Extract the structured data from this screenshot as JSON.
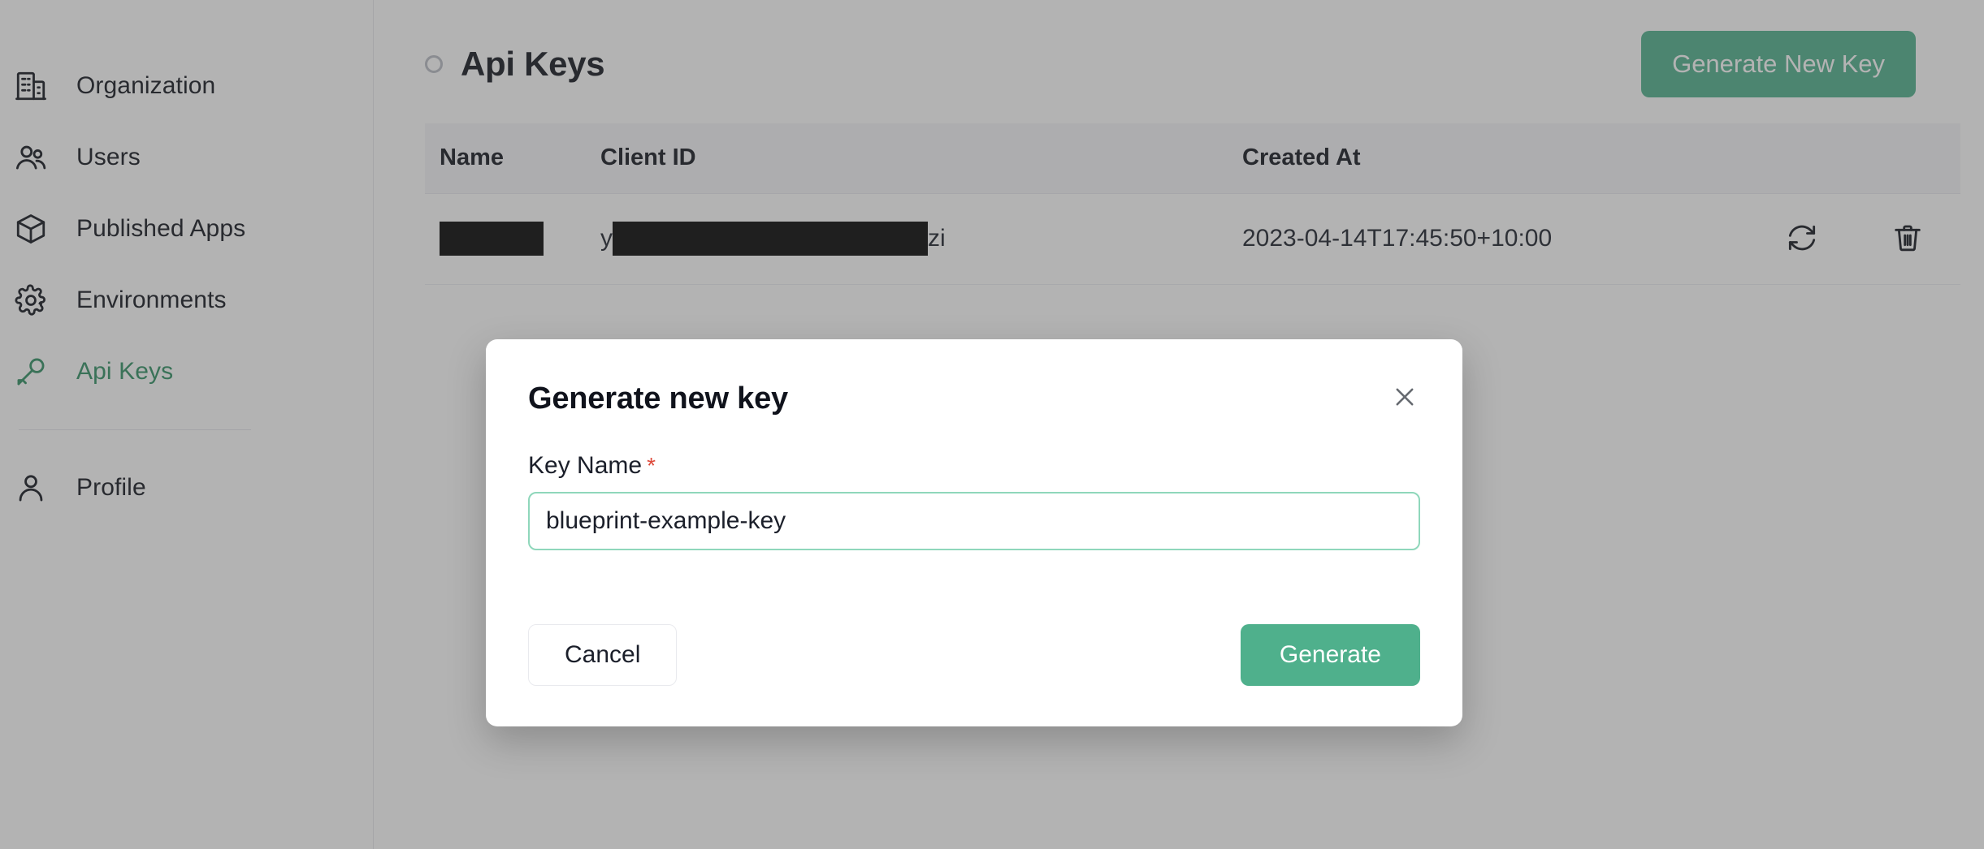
{
  "sidebar": {
    "items": [
      {
        "label": "Organization",
        "icon": "building-icon",
        "active": false
      },
      {
        "label": "Users",
        "icon": "users-icon",
        "active": false
      },
      {
        "label": "Published Apps",
        "icon": "cube-icon",
        "active": false
      },
      {
        "label": "Environments",
        "icon": "gear-icon",
        "active": false
      },
      {
        "label": "Api Keys",
        "icon": "key-icon",
        "active": true
      },
      {
        "label": "Profile",
        "icon": "user-icon",
        "active": false
      }
    ]
  },
  "header": {
    "title": "Api Keys",
    "status_icon": "spinner-icon",
    "generate_new_key_label": "Generate New Key"
  },
  "table": {
    "columns": [
      "Name",
      "Client ID",
      "Created At",
      ""
    ],
    "rows": [
      {
        "name": "",
        "name_redacted": true,
        "client_id_prefix": "y",
        "client_id_suffix": "zi",
        "client_id_redacted": true,
        "created_at": "2023-04-14T17:45:50+10:00",
        "actions": [
          "refresh-icon",
          "trash-icon"
        ]
      }
    ]
  },
  "modal": {
    "title": "Generate new key",
    "close_icon": "close-icon",
    "field_label": "Key Name",
    "required_marker": "*",
    "key_name_value": "blueprint-example-key",
    "key_name_placeholder": "Key Name",
    "cancel_label": "Cancel",
    "generate_label": "Generate"
  },
  "colors": {
    "accent_green": "#4FB08C",
    "active_nav_green": "#2f8f63",
    "required_red": "#de4b3c",
    "input_focus_border": "#8fd7bb",
    "text_dark": "#10131c",
    "table_header_bg": "#f4f5f8",
    "overlay": "rgba(74,74,74,0.42)"
  }
}
